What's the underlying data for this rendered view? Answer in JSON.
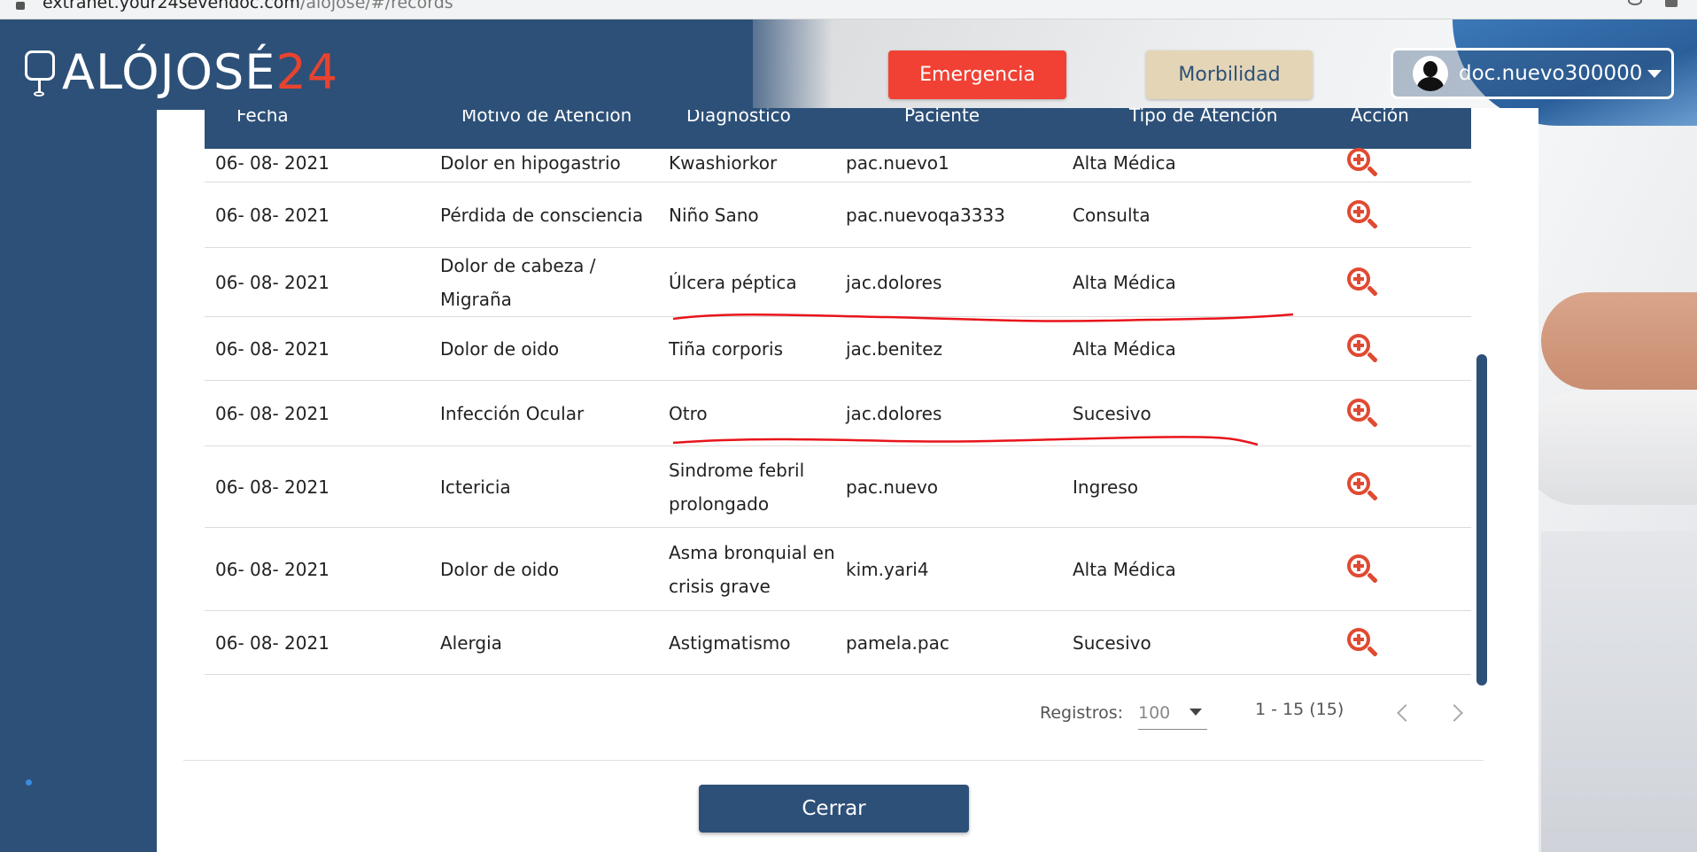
{
  "browser": {
    "url_host": "extranet.your24sevendoc.com",
    "url_path": "/alojose/#/records"
  },
  "header": {
    "logo_text": "ALÓJOSÉ",
    "logo_num": "24",
    "emergencia_label": "Emergencia",
    "morbilidad_label": "Morbilidad",
    "user_name": "doc.nuevo300000"
  },
  "table": {
    "columns": [
      "Fecha",
      "Motivo de Atención",
      "Diagnóstico",
      "Paciente",
      "Tipo de Atención",
      "Acción"
    ],
    "rows": [
      {
        "fecha": "06- 08- 2021",
        "motivo": [
          "Dolor en hipogastrio"
        ],
        "diagnostico": [
          "Kwashiorkor"
        ],
        "paciente": "pac.nuevo1",
        "tipo": "Alta Médica"
      },
      {
        "fecha": "06- 08- 2021",
        "motivo": [
          "Pérdida de consciencia"
        ],
        "diagnostico": [
          "Niño Sano"
        ],
        "paciente": "pac.nuevoqa3333",
        "tipo": "Consulta"
      },
      {
        "fecha": "06- 08- 2021",
        "motivo": [
          "Dolor de cabeza /",
          "Migraña"
        ],
        "diagnostico": [
          "Úlcera péptica"
        ],
        "paciente": "jac.dolores",
        "tipo": "Alta Médica"
      },
      {
        "fecha": "06- 08- 2021",
        "motivo": [
          "Dolor de oido"
        ],
        "diagnostico": [
          "Tiña corporis"
        ],
        "paciente": "jac.benitez",
        "tipo": "Alta Médica"
      },
      {
        "fecha": "06- 08- 2021",
        "motivo": [
          "Infección Ocular"
        ],
        "diagnostico": [
          "Otro"
        ],
        "paciente": "jac.dolores",
        "tipo": "Sucesivo"
      },
      {
        "fecha": "06- 08- 2021",
        "motivo": [
          "Ictericia"
        ],
        "diagnostico": [
          "Sindrome febril",
          "prolongado"
        ],
        "paciente": "pac.nuevo",
        "tipo": "Ingreso"
      },
      {
        "fecha": "06- 08- 2021",
        "motivo": [
          "Dolor de oido"
        ],
        "diagnostico": [
          "Asma bronquial en",
          "crisis grave"
        ],
        "paciente": "kim.yari4",
        "tipo": "Alta Médica"
      },
      {
        "fecha": "06- 08- 2021",
        "motivo": [
          "Alergia"
        ],
        "diagnostico": [
          "Astigmatismo"
        ],
        "paciente": "pamela.pac",
        "tipo": "Sucesivo"
      }
    ]
  },
  "pagination": {
    "registros_label": "Registros:",
    "page_size": "100",
    "range": "1 - 15 (15)"
  },
  "footer": {
    "cerrar_label": "Cerrar"
  },
  "colors": {
    "primary": "#2d5078",
    "emergency": "#f14134",
    "morbilidad": "#e3d5b6",
    "action_icon": "#e04a32",
    "annotation": "#e8141a"
  },
  "icons": {
    "action": "zoom-in-icon"
  }
}
